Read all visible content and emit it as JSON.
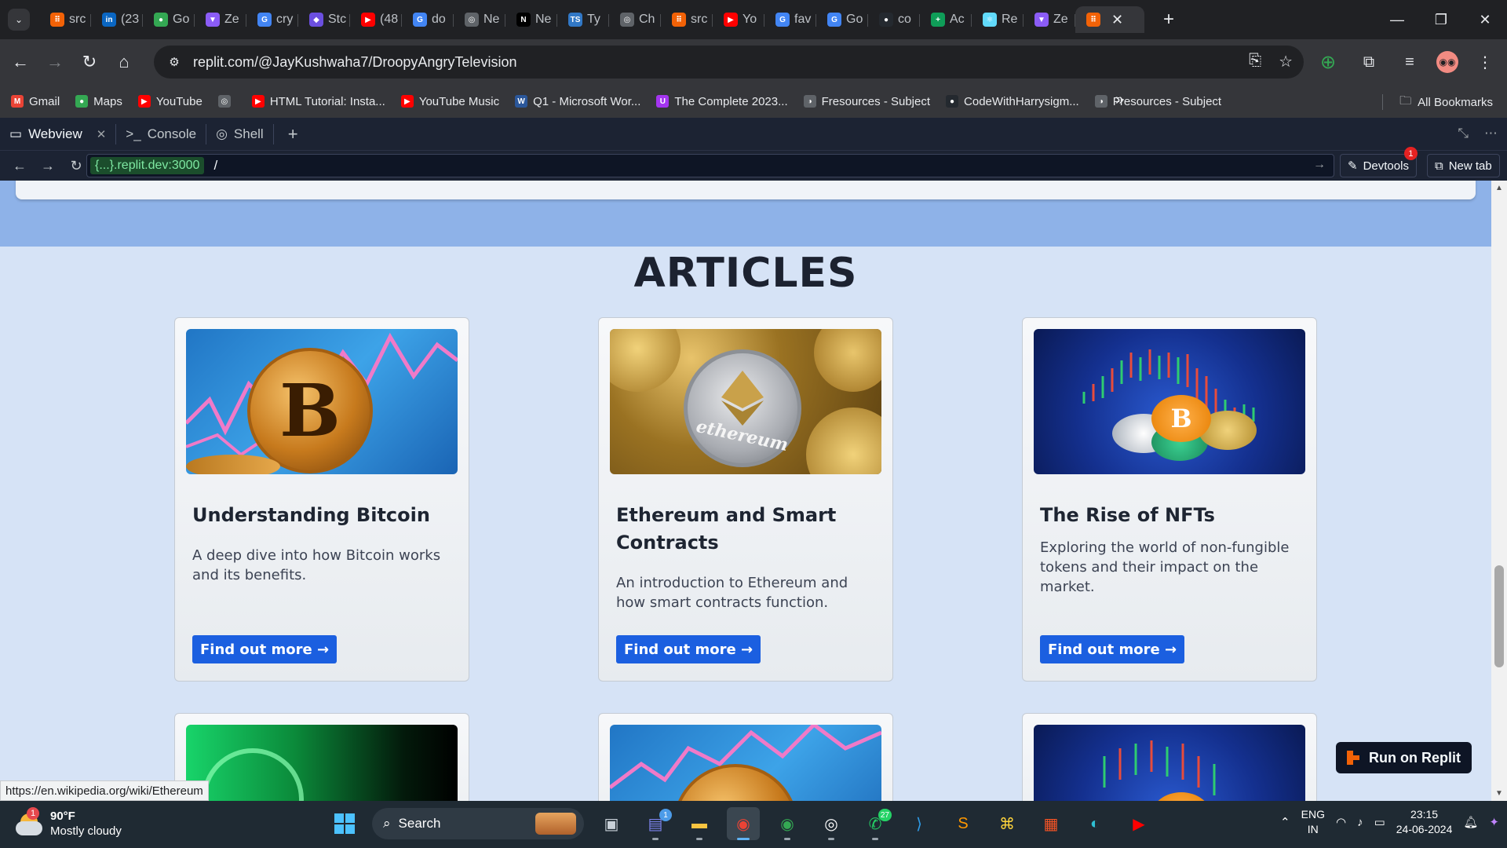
{
  "browser": {
    "tabs": [
      {
        "label": "src",
        "color": "#f26207",
        "glyph": "⠿"
      },
      {
        "label": "(23",
        "color": "#0a66c2",
        "glyph": "in"
      },
      {
        "label": "Go",
        "color": "#34a853",
        "glyph": "●"
      },
      {
        "label": "Ze",
        "color": "#8b5cf6",
        "glyph": "▼"
      },
      {
        "label": "cry",
        "color": "#4285f4",
        "glyph": "G"
      },
      {
        "label": "Stc",
        "color": "#6b4fe0",
        "glyph": "◆"
      },
      {
        "label": "(48",
        "color": "#ff0000",
        "glyph": "▶"
      },
      {
        "label": "do",
        "color": "#4285f4",
        "glyph": "G"
      },
      {
        "label": "Ne",
        "color": "#5f6368",
        "glyph": "◎"
      },
      {
        "label": "Ne",
        "color": "#000000",
        "glyph": "N"
      },
      {
        "label": "Ty",
        "color": "#3178c6",
        "glyph": "TS"
      },
      {
        "label": "Ch",
        "color": "#5f6368",
        "glyph": "◎"
      },
      {
        "label": "src",
        "color": "#f26207",
        "glyph": "⠿"
      },
      {
        "label": "Yo",
        "color": "#ff0000",
        "glyph": "▶"
      },
      {
        "label": "fav",
        "color": "#4285f4",
        "glyph": "G"
      },
      {
        "label": "Go",
        "color": "#4285f4",
        "glyph": "G"
      },
      {
        "label": "co",
        "color": "#24292f",
        "glyph": "●"
      },
      {
        "label": "Ac",
        "color": "#0f9d58",
        "glyph": "+"
      },
      {
        "label": "Re",
        "color": "#61dafb",
        "glyph": "⚛"
      },
      {
        "label": "Ze",
        "color": "#8b5cf6",
        "glyph": "▼"
      }
    ],
    "active_tab_glyph": "⠿",
    "url": "replit.com/@JayKushwaha7/DroopyAngryTelevision",
    "bookmarks": [
      {
        "label": "Gmail",
        "color": "#ea4335",
        "glyph": "M"
      },
      {
        "label": "Maps",
        "color": "#34a853",
        "glyph": "●"
      },
      {
        "label": "YouTube",
        "color": "#ff0000",
        "glyph": "▶"
      },
      {
        "label": "",
        "color": "#5f6368",
        "glyph": "◎"
      },
      {
        "label": "HTML Tutorial: Insta...",
        "color": "#ff0000",
        "glyph": "▶"
      },
      {
        "label": "YouTube Music",
        "color": "#ff0000",
        "glyph": "▶"
      },
      {
        "label": "Q1 - Microsoft Wor...",
        "color": "#2b579a",
        "glyph": "W"
      },
      {
        "label": "The Complete 2023...",
        "color": "#a435f0",
        "glyph": "U"
      },
      {
        "label": "Fresources - Subject",
        "color": "#5f6368",
        "glyph": "◑"
      },
      {
        "label": "CodeWithHarrysigm...",
        "color": "#24292f",
        "glyph": "●"
      },
      {
        "label": "Fresources - Subject",
        "color": "#5f6368",
        "glyph": "◑"
      }
    ],
    "all_bookmarks": "All Bookmarks"
  },
  "replit": {
    "tabs": [
      {
        "label": "Webview",
        "icon": "monitor-icon"
      },
      {
        "label": "Console",
        "icon": "terminal-icon"
      },
      {
        "label": "Shell",
        "icon": "shell-icon"
      }
    ],
    "host": "{...}.replit.dev:3000",
    "path": "/",
    "devtools_label": "Devtools",
    "devtools_badge": "1",
    "new_tab_label": "New tab",
    "run_label": "Run on Replit"
  },
  "page": {
    "heading": "ARTICLES",
    "articles": [
      {
        "title": "Understanding Bitcoin",
        "desc": "A deep dive into how Bitcoin works and its benefits.",
        "button": "Find out more →"
      },
      {
        "title": "Ethereum and Smart Contracts",
        "desc": "An introduction to Ethereum and how smart contracts function.",
        "button": "Find out more →"
      },
      {
        "title": "The Rise of NFTs",
        "desc": "Exploring the world of non-fungible tokens and their impact on the market.",
        "button": "Find out more →"
      }
    ],
    "eth_coin_text": "ethereum",
    "btc_glyph": "B"
  },
  "status_bar_url": "https://en.wikipedia.org/wiki/Ethereum",
  "taskbar": {
    "weather_temp": "90°F",
    "weather_desc": "Mostly cloudy",
    "weather_badge": "1",
    "search_label": "Search",
    "teams_badge": "1",
    "whatsapp_badge": "27",
    "lang_line1": "ENG",
    "lang_line2": "IN",
    "time": "23:15",
    "date": "24-06-2024"
  }
}
